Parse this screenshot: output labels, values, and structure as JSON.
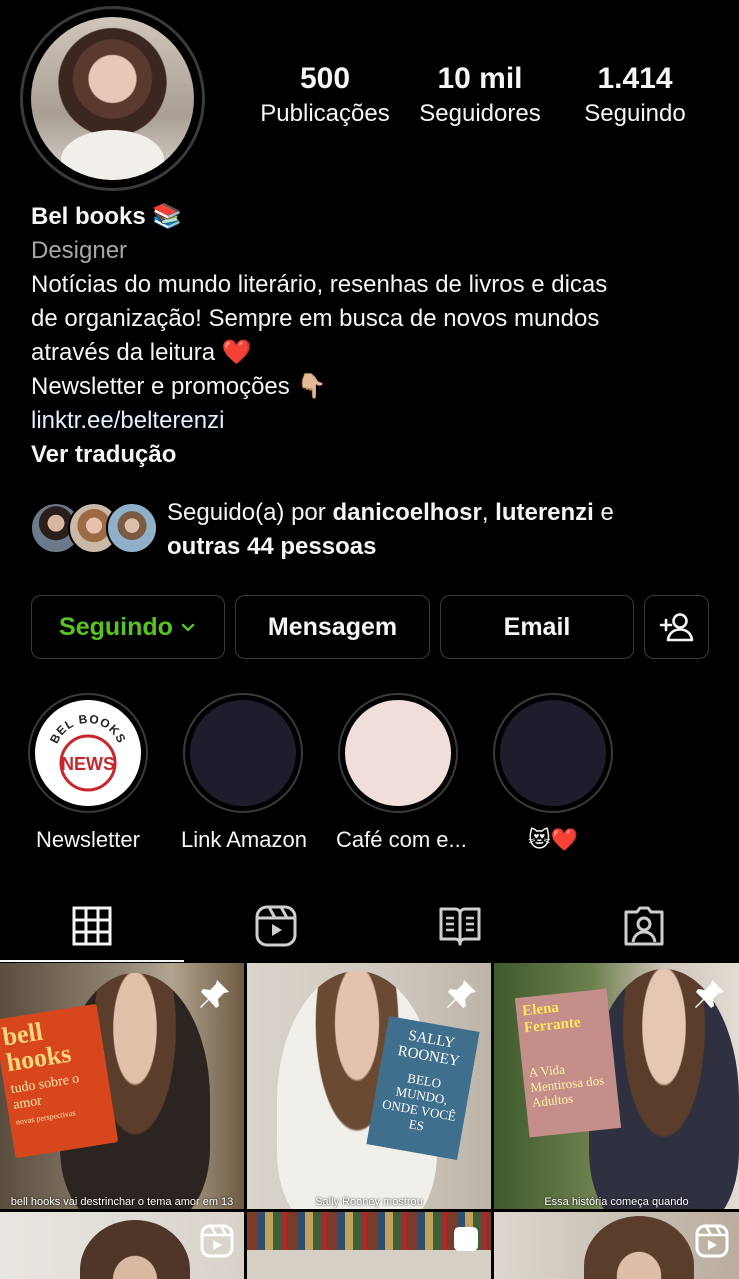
{
  "profile": {
    "stats": [
      {
        "value": "500",
        "label": "Publicações"
      },
      {
        "value": "10 mil",
        "label": "Seguidores"
      },
      {
        "value": "1.414",
        "label": "Seguindo"
      }
    ],
    "name": "Bel books 📚",
    "category": "Designer",
    "bio_line1": "Notícias do mundo literário, resenhas de livros e dicas",
    "bio_line2": "de organização! Sempre em busca de novos mundos",
    "bio_line3": "através da leitura ❤️",
    "bio_line4": "Newsletter e promoções 👇🏼",
    "link": "linktr.ee/belterenzi",
    "translate": "Ver tradução"
  },
  "followed_by": {
    "prefix": "Seguido(a) por ",
    "user1": "danicoelhosr",
    "sep": ", ",
    "user2": "luterenzi",
    "and": " e",
    "others": "outras 44 pessoas"
  },
  "buttons": {
    "following": "Seguindo",
    "message": "Mensagem",
    "email": "Email"
  },
  "highlights": [
    {
      "label": "Newsletter",
      "badge_top": "BEL BOOKS",
      "badge_center": "NEWS",
      "color": "#ffffff"
    },
    {
      "label": "Link Amazon",
      "color": "#1f1d2b"
    },
    {
      "label": "Café com e...",
      "color": "#f0dedb"
    },
    {
      "label": "😻❤️",
      "color": "#1f1d2b"
    }
  ],
  "tabs": [
    "grid-icon",
    "reels-icon",
    "guides-icon",
    "tagged-icon"
  ],
  "posts": [
    {
      "caption": "bell hooks vai destrinchar o tema amor em 13",
      "book_title": "bell hooks",
      "book_sub": "tudo sobre o amor",
      "book_note": "novas perspectivas",
      "pinned": true
    },
    {
      "caption": "Sally Rooney mostrou",
      "book_title": "SALLY ROONEY",
      "book_sub": "BELO MUNDO, ONDE VOCÊ ES",
      "pinned": true
    },
    {
      "caption": "Essa história começa quando",
      "book_title": "Elena Ferrante",
      "book_sub": "A Vida Mentirosa dos Adultos",
      "pinned": true
    }
  ],
  "colors": {
    "following_green": "#58c322",
    "news_red": "#c8262b",
    "border": "#3a3a3a"
  }
}
